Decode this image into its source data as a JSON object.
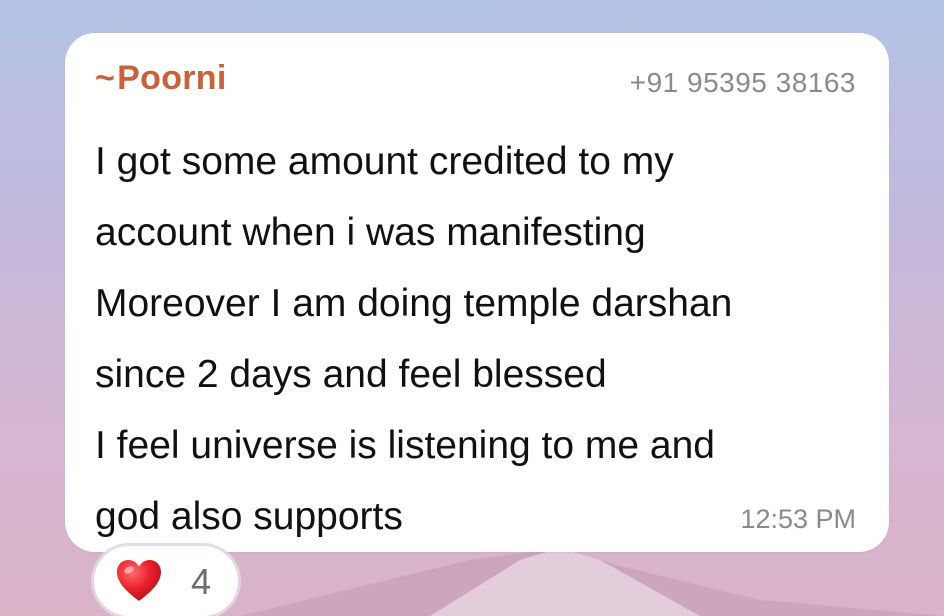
{
  "message": {
    "sender_prefix": "~",
    "sender_name": "Poorni",
    "phone": "+91 95395 38163",
    "lines": [
      "I got some amount credited to my",
      "account when i was manifesting",
      "Moreover I am doing temple darshan",
      "since 2 days and feel blessed",
      "I feel universe is listening to me and",
      "god also supports"
    ],
    "time": "12:53 PM"
  },
  "reaction": {
    "icon": "red-heart-icon",
    "count": "4"
  },
  "colors": {
    "sender": "#c8613c",
    "meta": "#8a8a8e",
    "bubble": "#ffffff",
    "heart": "#e8202a"
  }
}
